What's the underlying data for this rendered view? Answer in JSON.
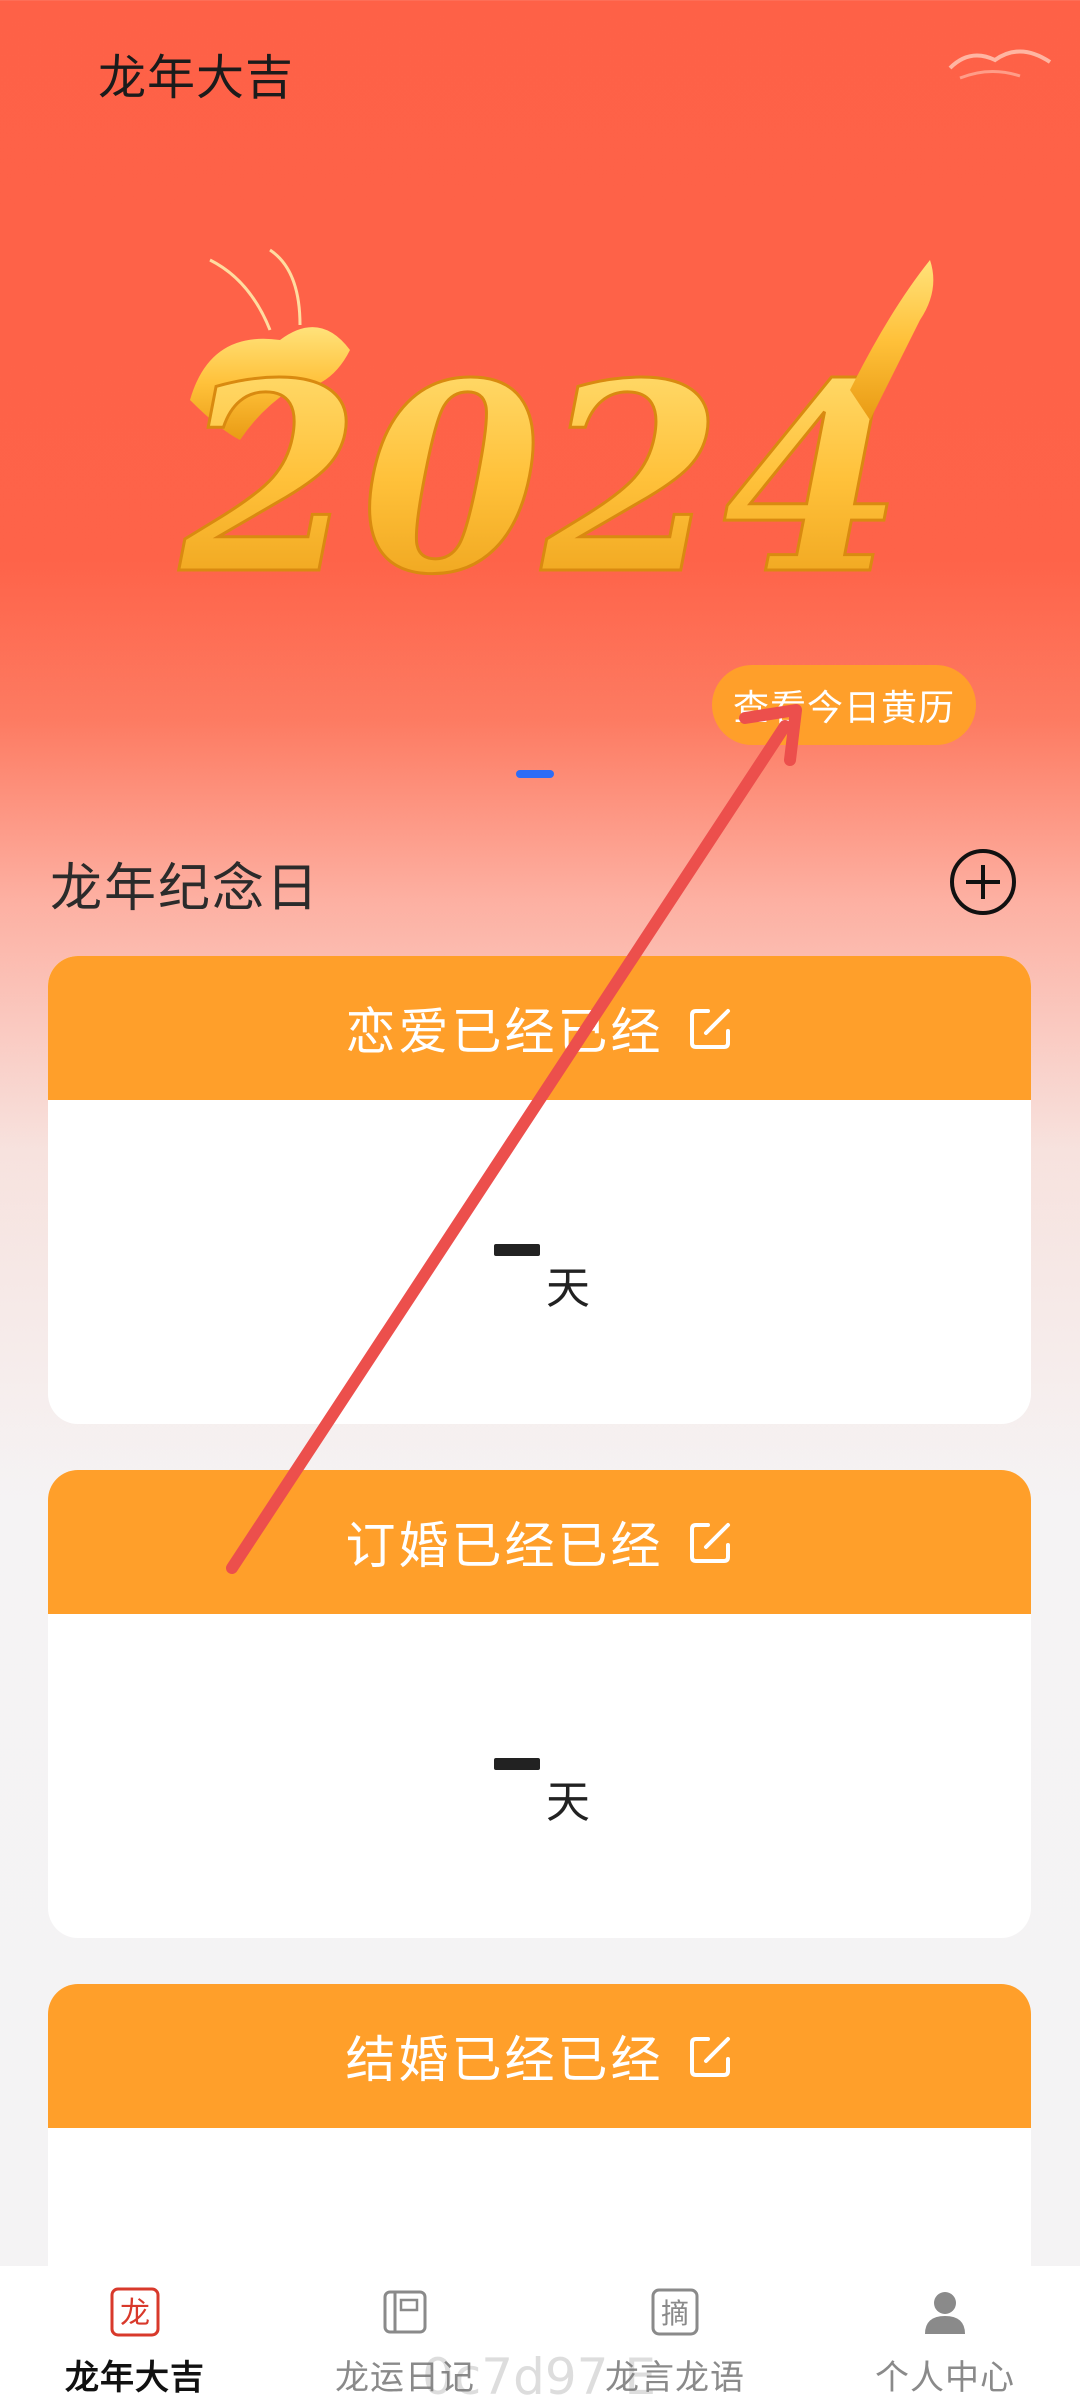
{
  "header": {
    "title": "龙年大吉"
  },
  "hero": {
    "image_text": "2024",
    "almanac_button": "查看今日黄历"
  },
  "section": {
    "title": "龙年纪念日"
  },
  "cards": [
    {
      "title": "恋爱已经已经",
      "days": "一",
      "unit": "天"
    },
    {
      "title": "订婚已经已经",
      "days": "一",
      "unit": "天"
    },
    {
      "title": "结婚已经已经",
      "days": "",
      "unit": ""
    }
  ],
  "tabs": [
    {
      "label": "龙年大吉",
      "icon": "dragon-seal-icon",
      "icon_char": "龙",
      "active": true
    },
    {
      "label": "龙运日记",
      "icon": "diary-icon",
      "active": false
    },
    {
      "label": "龙言龙语",
      "icon": "quote-icon",
      "icon_char": "摘",
      "active": false
    },
    {
      "label": "个人中心",
      "icon": "person-icon",
      "active": false
    }
  ],
  "watermark": "0c7d97 E",
  "colors": {
    "accent": "#ff9f2a",
    "header_red": "#fe6147",
    "indicator": "#2e6cf6",
    "arrow": "#ec4f4c"
  }
}
